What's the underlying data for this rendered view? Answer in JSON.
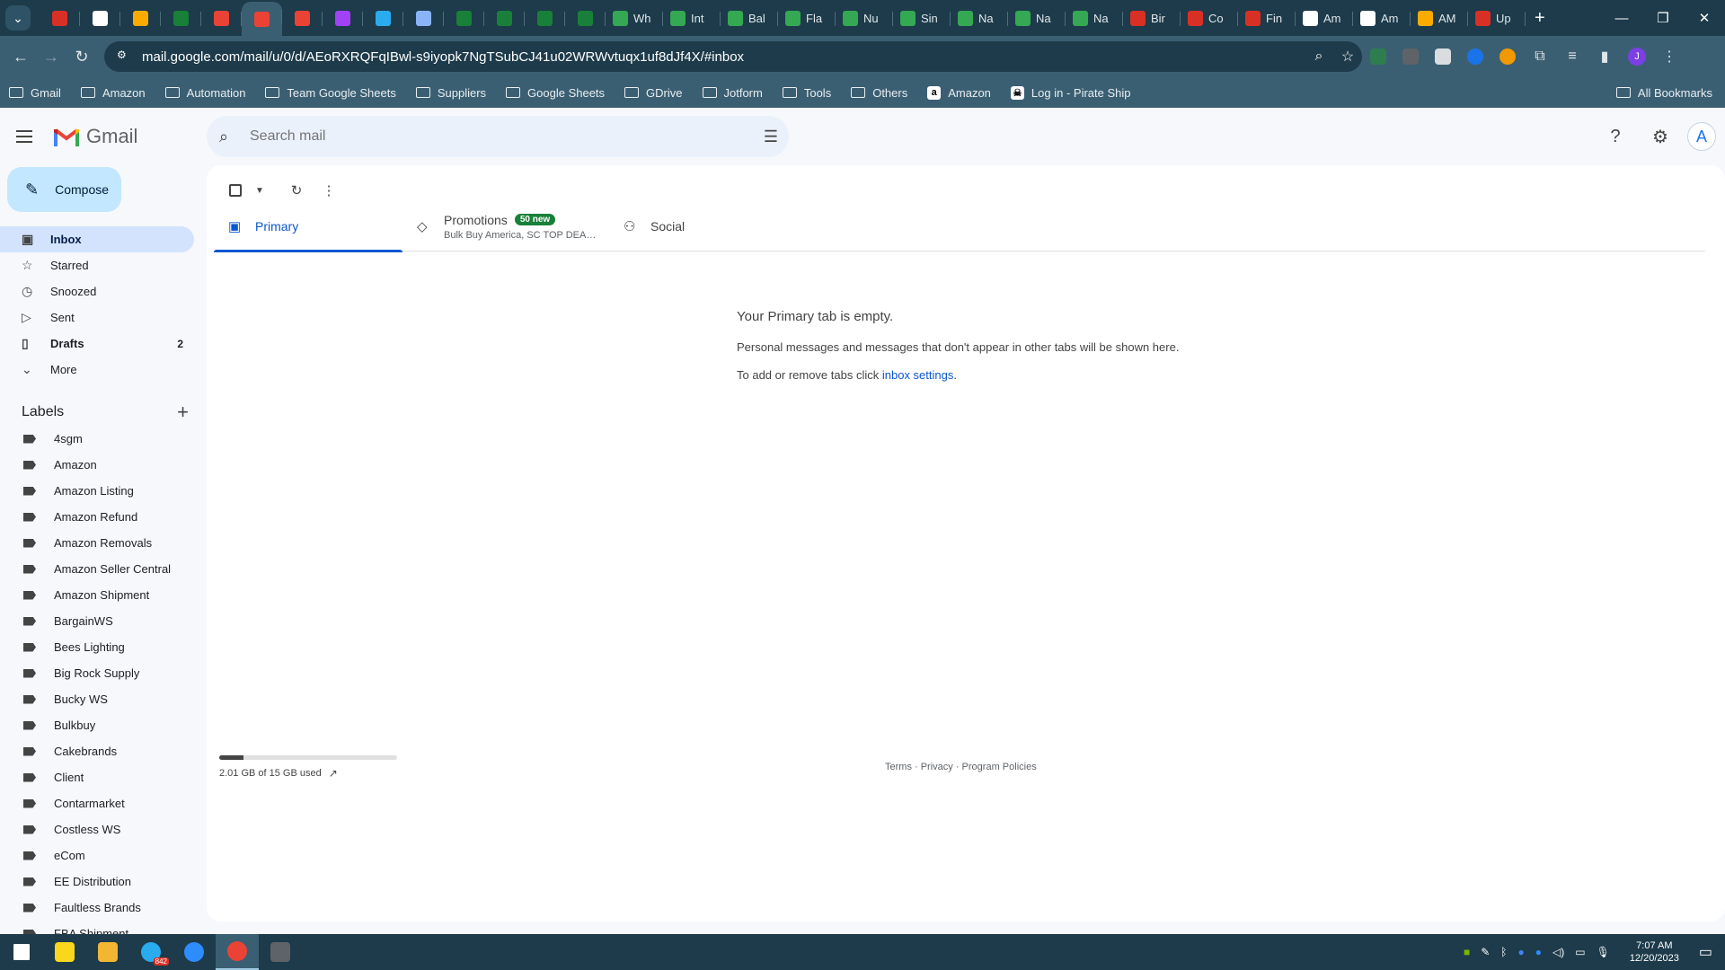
{
  "browser": {
    "tabs": [
      {
        "icon": "pdf-icon",
        "color": "#d93025",
        "label": ""
      },
      {
        "icon": "amazon-icon",
        "color": "#ffffff",
        "label": ""
      },
      {
        "icon": "pen-icon",
        "color": "#f9ab00",
        "label": ""
      },
      {
        "icon": "sheets-icon",
        "color": "#188038",
        "label": ""
      },
      {
        "icon": "gmail-icon",
        "color": "#ea4335",
        "label": ""
      },
      {
        "icon": "gmail-icon",
        "color": "#ea4335",
        "label": "",
        "active": true
      },
      {
        "icon": "gmail-icon",
        "color": "#ea4335",
        "label": ""
      },
      {
        "icon": "messenger-icon",
        "color": "#a142f4",
        "label": ""
      },
      {
        "icon": "telegram-icon",
        "color": "#2aabee",
        "label": ""
      },
      {
        "icon": "chart-icon",
        "color": "#8ab4f8",
        "label": ""
      },
      {
        "icon": "sheets-icon",
        "color": "#188038",
        "label": ""
      },
      {
        "icon": "sheets-icon",
        "color": "#188038",
        "label": ""
      },
      {
        "icon": "sheets-icon",
        "color": "#188038",
        "label": ""
      },
      {
        "icon": "sheets-icon",
        "color": "#188038",
        "label": ""
      },
      {
        "icon": "leaf-icon",
        "color": "#34a853",
        "label": "Wh"
      },
      {
        "icon": "leaf-icon",
        "color": "#34a853",
        "label": "Int"
      },
      {
        "icon": "leaf-icon",
        "color": "#34a853",
        "label": "Bal"
      },
      {
        "icon": "leaf-icon",
        "color": "#34a853",
        "label": "Fla"
      },
      {
        "icon": "leaf-icon",
        "color": "#34a853",
        "label": "Nu"
      },
      {
        "icon": "leaf-icon",
        "color": "#34a853",
        "label": "Sin"
      },
      {
        "icon": "leaf-icon",
        "color": "#34a853",
        "label": "Na"
      },
      {
        "icon": "leaf-icon",
        "color": "#34a853",
        "label": "Na"
      },
      {
        "icon": "leaf-icon",
        "color": "#34a853",
        "label": "Na"
      },
      {
        "icon": "leaf-icon",
        "color": "#d93025",
        "label": "Bir"
      },
      {
        "icon": "leaf-icon",
        "color": "#d93025",
        "label": "Co"
      },
      {
        "icon": "leaf-icon",
        "color": "#d93025",
        "label": "Fin"
      },
      {
        "icon": "amazon-icon",
        "color": "#ffffff",
        "label": "Am"
      },
      {
        "icon": "amazon-icon",
        "color": "#ffffff",
        "label": "Am"
      },
      {
        "icon": "pen-icon",
        "color": "#f9ab00",
        "label": "AM"
      },
      {
        "icon": "shield-icon",
        "color": "#d93025",
        "label": "Up"
      }
    ],
    "new_tab": "+",
    "url": "mail.google.com/mail/u/0/d/AEoRXRQFqIBwl-s9iyopk7NgTSubCJ41u02WRWvtuqx1uf8dJf4X/#inbox",
    "profile_initial": "J",
    "bookmarks": [
      {
        "type": "folder",
        "label": "Gmail"
      },
      {
        "type": "folder",
        "label": "Amazon"
      },
      {
        "type": "folder",
        "label": "Automation"
      },
      {
        "type": "folder",
        "label": "Team Google Sheets"
      },
      {
        "type": "folder",
        "label": "Suppliers"
      },
      {
        "type": "folder",
        "label": "Google Sheets"
      },
      {
        "type": "folder",
        "label": "GDrive"
      },
      {
        "type": "folder",
        "label": "Jotform"
      },
      {
        "type": "folder",
        "label": "Tools"
      },
      {
        "type": "folder",
        "label": "Others"
      },
      {
        "type": "site",
        "label": "Amazon",
        "glyph": "a"
      },
      {
        "type": "site",
        "label": "Log in - Pirate Ship",
        "glyph": "☠"
      }
    ],
    "all_bookmarks": "All Bookmarks"
  },
  "gmail": {
    "logo_text": "Gmail",
    "search_placeholder": "Search mail",
    "avatar_initial": "A",
    "compose": "Compose",
    "nav": [
      {
        "label": "Inbox",
        "icon": "inbox-icon",
        "glyph": "▣",
        "count": "",
        "active": true
      },
      {
        "label": "Starred",
        "icon": "star-icon",
        "glyph": "☆",
        "count": ""
      },
      {
        "label": "Snoozed",
        "icon": "clock-icon",
        "glyph": "◷",
        "count": ""
      },
      {
        "label": "Sent",
        "icon": "send-icon",
        "glyph": "▷",
        "count": ""
      },
      {
        "label": "Drafts",
        "icon": "draft-icon",
        "glyph": "▯",
        "count": "2",
        "bold": true
      },
      {
        "label": "More",
        "icon": "chevron-down-icon",
        "glyph": "⌄",
        "count": ""
      }
    ],
    "labels_title": "Labels",
    "labels": [
      "4sgm",
      "Amazon",
      "Amazon Listing",
      "Amazon Refund",
      "Amazon Removals",
      "Amazon Seller Central",
      "Amazon Shipment",
      "BargainWS",
      "Bees Lighting",
      "Big Rock Supply",
      "Bucky WS",
      "Bulkbuy",
      "Cakebrands",
      "Client",
      "Contarmarket",
      "Costless WS",
      "eCom",
      "EE Distribution",
      "Faultless Brands",
      "FBA Shipment"
    ],
    "tabs": {
      "primary": "Primary",
      "promotions": "Promotions",
      "promotions_badge": "50 new",
      "promotions_sub": "Bulk Buy America, SC TOP DEAL...",
      "social": "Social"
    },
    "empty": {
      "title": "Your Primary tab is empty.",
      "line1": "Personal messages and messages that don't appear in other tabs will be shown here.",
      "line2_prefix": "To add or remove tabs click ",
      "line2_link": "inbox settings",
      "line2_suffix": "."
    },
    "storage": {
      "text": "2.01 GB of 15 GB used",
      "used_fraction": 0.134
    },
    "footer": "Terms · Privacy · Program Policies"
  },
  "taskbar": {
    "apps": [
      {
        "icon": "windows-start-icon",
        "color": "#ffffff"
      },
      {
        "icon": "sticky-notes-icon",
        "color": "#f9d71c"
      },
      {
        "icon": "file-explorer-icon",
        "color": "#f2b632"
      },
      {
        "icon": "telegram-icon",
        "color": "#2aabee",
        "badge": "842"
      },
      {
        "icon": "zoom-icon",
        "color": "#2d8cff"
      },
      {
        "icon": "chrome-icon",
        "color": "#ea4335",
        "active": true
      },
      {
        "icon": "calculator-icon",
        "color": "#5f6368"
      }
    ],
    "time": "7:07 AM",
    "date": "12/20/2023"
  }
}
